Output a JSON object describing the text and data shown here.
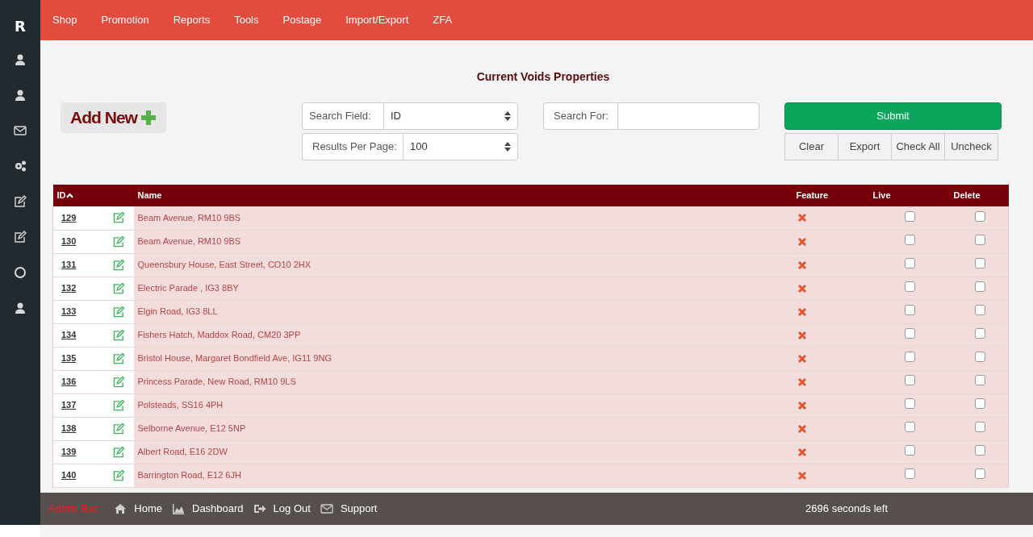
{
  "sidebar": {
    "logo": "R"
  },
  "nav": [
    "Shop",
    "Promotion",
    "Reports",
    "Tools",
    "Postage",
    "Import/Export",
    "ZFA"
  ],
  "title": "Current Voids Properties",
  "add_button": "Add New",
  "search": {
    "field_label": "Search Field:",
    "field_value": "ID",
    "per_page_label": "Results Per Page:",
    "per_page_value": "100",
    "for_label": "Search For:"
  },
  "buttons": {
    "submit": "Submit",
    "actions": [
      "Clear",
      "Export",
      "Check All",
      "Uncheck"
    ]
  },
  "table": {
    "columns": [
      "ID",
      "Name",
      "Feature",
      "Live",
      "Delete"
    ],
    "rows": [
      {
        "id": "129",
        "name": "Beam Avenue, RM10 9BS",
        "feature": false,
        "live": false,
        "delete": false
      },
      {
        "id": "130",
        "name": "Beam Avenue, RM10 9BS",
        "feature": false,
        "live": false,
        "delete": false
      },
      {
        "id": "131",
        "name": "Queensbury House, East Street, CO10 2HX",
        "feature": false,
        "live": false,
        "delete": false
      },
      {
        "id": "132",
        "name": "Electric Parade , IG3 8BY",
        "feature": false,
        "live": false,
        "delete": false
      },
      {
        "id": "133",
        "name": "Elgin Road, IG3 8LL",
        "feature": false,
        "live": false,
        "delete": false
      },
      {
        "id": "134",
        "name": "Fishers Hatch, Maddox Road, CM20 3PP",
        "feature": false,
        "live": false,
        "delete": false
      },
      {
        "id": "135",
        "name": "Bristol House, Margaret Bondfield Ave, IG11 9NG",
        "feature": false,
        "live": false,
        "delete": false
      },
      {
        "id": "136",
        "name": "Princess Parade, New Road, RM10 9LS",
        "feature": false,
        "live": false,
        "delete": false
      },
      {
        "id": "137",
        "name": "Polsteads, SS16 4PH",
        "feature": false,
        "live": false,
        "delete": false
      },
      {
        "id": "138",
        "name": "Selborne Avenue, E12 5NP",
        "feature": false,
        "live": false,
        "delete": false
      },
      {
        "id": "139",
        "name": "Albert Road, E16 2DW",
        "feature": false,
        "live": false,
        "delete": false
      },
      {
        "id": "140",
        "name": "Barrington Road, E12 6JH",
        "feature": false,
        "live": false,
        "delete": false
      }
    ]
  },
  "admin_bar": {
    "label": "Admin Bar:",
    "links": [
      "Home",
      "Dashboard",
      "Log Out",
      "Support"
    ],
    "timer": "2696 seconds left"
  }
}
